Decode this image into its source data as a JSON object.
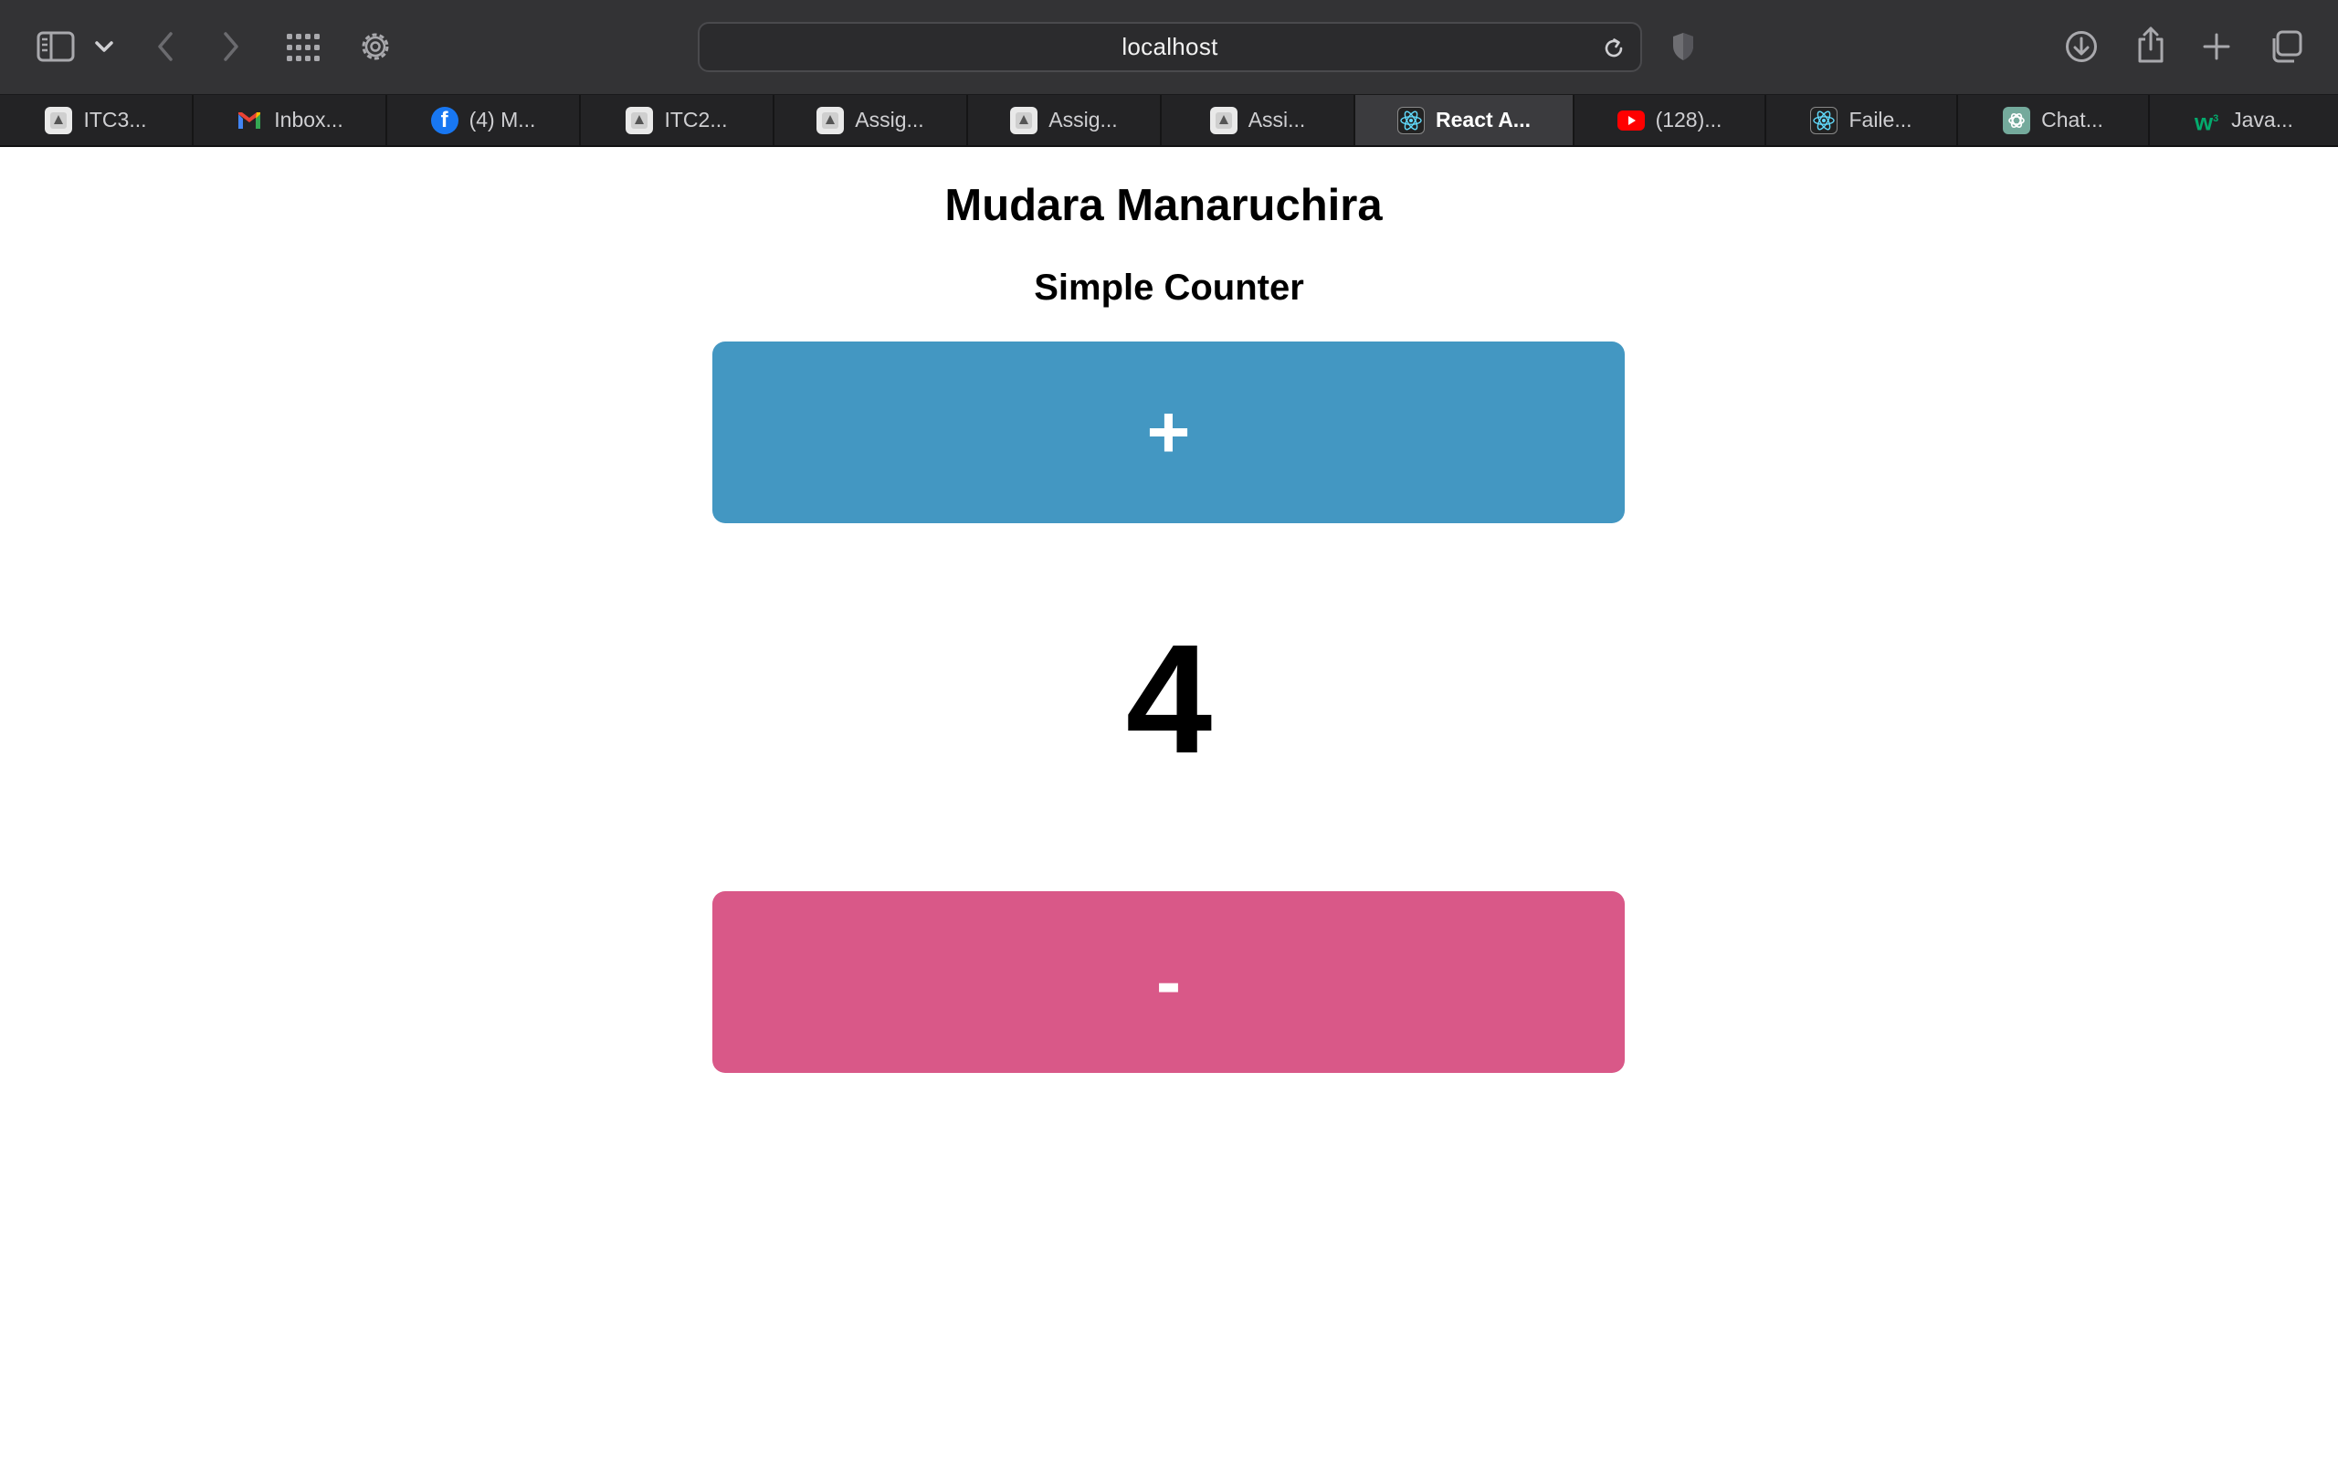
{
  "browser": {
    "address": "localhost",
    "tabs": [
      {
        "label": "ITC3...",
        "icon": "document-icon",
        "active": false
      },
      {
        "label": "Inbox...",
        "icon": "gmail-icon",
        "active": false
      },
      {
        "label": "(4) M...",
        "icon": "facebook-icon",
        "active": false
      },
      {
        "label": "ITC2...",
        "icon": "document-icon",
        "active": false
      },
      {
        "label": "Assig...",
        "icon": "document-icon",
        "active": false
      },
      {
        "label": "Assig...",
        "icon": "document-icon",
        "active": false
      },
      {
        "label": "Assi...",
        "icon": "document-icon",
        "active": false
      },
      {
        "label": "React A...",
        "icon": "react-icon",
        "active": true
      },
      {
        "label": "(128)...",
        "icon": "youtube-icon",
        "active": false
      },
      {
        "label": "Faile...",
        "icon": "react-icon",
        "active": false
      },
      {
        "label": "Chat...",
        "icon": "chatgpt-icon",
        "active": false
      },
      {
        "label": "Java...",
        "icon": "w3schools-icon",
        "active": false
      }
    ]
  },
  "page": {
    "name": "Mudara Manaruchira",
    "title": "Simple Counter",
    "increment_label": "+",
    "decrement_label": "-",
    "count": "4"
  },
  "colors": {
    "increment_button": "#4397c2",
    "decrement_button": "#d95888",
    "toolbar": "#333335"
  }
}
